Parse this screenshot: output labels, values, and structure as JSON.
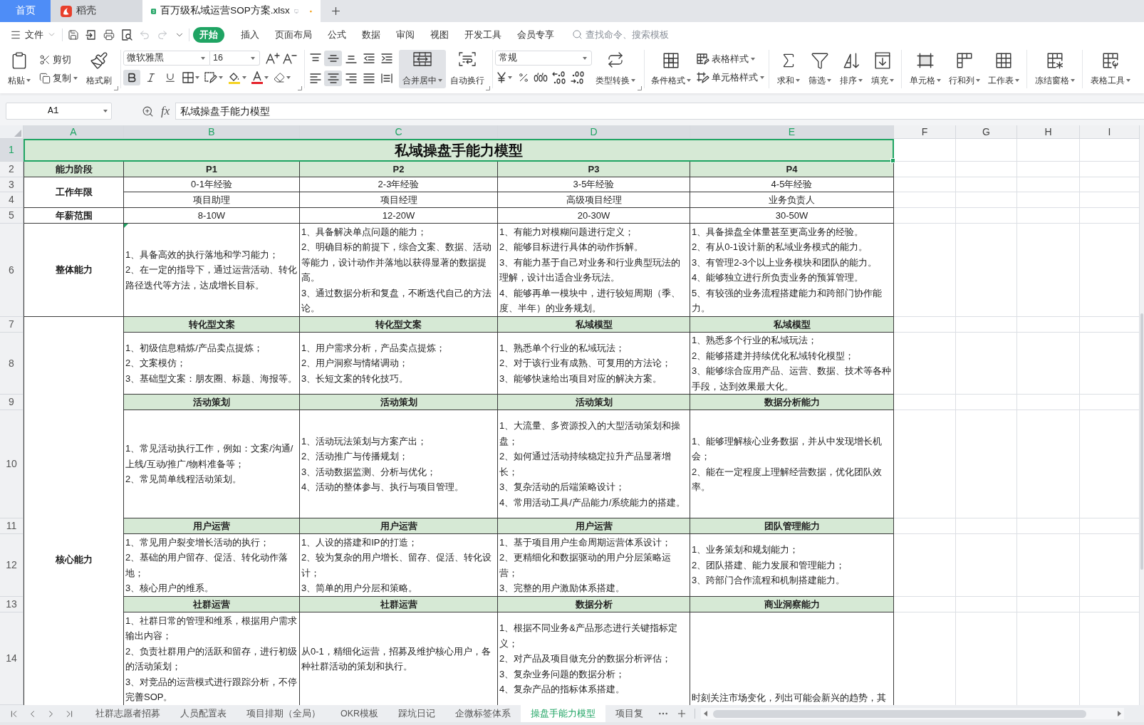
{
  "tabs": [
    {
      "kind": "home",
      "label": "首页",
      "selected": false,
      "unsaved": false
    },
    {
      "kind": "docer",
      "label": "稻壳",
      "selected": false,
      "unsaved": false
    },
    {
      "kind": "spreadsheet",
      "label": "百万级私域运营SOP方案.xlsx",
      "selected": true,
      "unsaved": true
    }
  ],
  "menu": {
    "file": "文件",
    "items": [
      {
        "label": "开始",
        "selected": true
      },
      {
        "label": "插入",
        "selected": false
      },
      {
        "label": "页面布局",
        "selected": false
      },
      {
        "label": "公式",
        "selected": false
      },
      {
        "label": "数据",
        "selected": false
      },
      {
        "label": "审阅",
        "selected": false
      },
      {
        "label": "视图",
        "selected": false
      },
      {
        "label": "开发工具",
        "selected": false
      },
      {
        "label": "会员专享",
        "selected": false
      }
    ],
    "search": {
      "placeholder": "查找命令、搜索模板"
    }
  },
  "toolbar": {
    "clipboard": {
      "paste": "粘贴",
      "cut": "剪切",
      "copy": "复制",
      "format_painter": "格式刷"
    },
    "font": {
      "name": "微软雅黑",
      "size": "16",
      "styles": [
        {
          "kind": "bold",
          "selected": true
        },
        {
          "kind": "italic",
          "selected": false
        },
        {
          "kind": "underline",
          "selected": false
        }
      ]
    },
    "alignment": {
      "vertical": [
        {
          "kind": "top",
          "selected": false
        },
        {
          "kind": "middle",
          "selected": true
        },
        {
          "kind": "bottom",
          "selected": false
        }
      ],
      "horizontal": [
        {
          "kind": "left",
          "selected": false
        },
        {
          "kind": "center",
          "selected": true
        },
        {
          "kind": "right",
          "selected": false
        },
        {
          "kind": "justify",
          "selected": false
        },
        {
          "kind": "distributed",
          "selected": false
        }
      ]
    },
    "layout_buttons": [
      {
        "kind": "merge",
        "label": "合并居中",
        "selected": true
      },
      {
        "kind": "wrap",
        "label": "自动换行",
        "selected": false
      }
    ],
    "number": {
      "format": "常规",
      "convert": "类型转换"
    },
    "styles": {
      "conditional": "条件格式",
      "table_style": "表格样式",
      "cell_style": "单元格样式"
    },
    "tool_groups": [
      [
        {
          "kind": "sum",
          "label": "求和"
        },
        {
          "kind": "filter",
          "label": "筛选"
        },
        {
          "kind": "sort",
          "label": "排序"
        },
        {
          "kind": "fill",
          "label": "填充"
        }
      ],
      [
        {
          "kind": "cell",
          "label": "单元格"
        },
        {
          "kind": "rows_columns",
          "label": "行和列"
        },
        {
          "kind": "worksheet",
          "label": "工作表"
        }
      ],
      [
        {
          "kind": "freeze",
          "label": "冻结窗格"
        }
      ],
      [
        {
          "kind": "table_tools",
          "label": "表格工具"
        }
      ]
    ]
  },
  "formula_bar": {
    "cell": "A1",
    "function_symbol": "fx",
    "value": "私域操盘手能力模型"
  },
  "sheet": {
    "columns": [
      {
        "label": "A",
        "selected": true
      },
      {
        "label": "B",
        "selected": true
      },
      {
        "label": "C",
        "selected": true
      },
      {
        "label": "D",
        "selected": true
      },
      {
        "label": "E",
        "selected": true
      },
      {
        "label": "F",
        "selected": false
      },
      {
        "label": "G",
        "selected": false
      },
      {
        "label": "H",
        "selected": false
      },
      {
        "label": "I",
        "selected": false
      }
    ],
    "rows": [
      {
        "label": "1",
        "selected": true
      },
      {
        "label": "2",
        "selected": false
      },
      {
        "label": "3",
        "selected": false
      },
      {
        "label": "4",
        "selected": false
      },
      {
        "label": "5",
        "selected": false
      },
      {
        "label": "6",
        "selected": false
      },
      {
        "label": "7",
        "selected": false
      },
      {
        "label": "8",
        "selected": false
      },
      {
        "label": "9",
        "selected": false
      },
      {
        "label": "10",
        "selected": false
      },
      {
        "label": "11",
        "selected": false
      },
      {
        "label": "12",
        "selected": false
      },
      {
        "label": "13",
        "selected": false
      },
      {
        "label": "14",
        "selected": false
      }
    ],
    "title": "私域操盘手能力模型",
    "stage": {
      "label": "能力阶段",
      "levels": [
        "P1",
        "P2",
        "P3",
        "P4"
      ]
    },
    "experience": {
      "label": "工作年限",
      "years": [
        "0-1年经验",
        "2-3年经验",
        "3-5年经验",
        "4-5年经验"
      ],
      "roles": [
        "项目助理",
        "项目经理",
        "高级项目经理",
        "业务负责人"
      ]
    },
    "salary": {
      "label": "年薪范围",
      "values": [
        "8-10W",
        "12-20W",
        "20-30W",
        "30-50W"
      ]
    },
    "overall": {
      "label": "整体能力",
      "cells": [
        [
          "1、具备高效的执行落地和学习能力；",
          "2、在一定的指导下，通过运营活动、转化路径迭代等方法，达成增长目标。"
        ],
        [
          "1、具备解决单点问题的能力；",
          "2、明确目标的前提下，综合文案、数据、活动等能力，设计动作并落地以获得显著的数据提高。",
          "3、通过数据分析和复盘，不断迭代自己的方法论。"
        ],
        [
          "1、有能力对模糊问题进行定义；",
          "2、能够目标进行具体的动作拆解。",
          "3、有能力基于自己对业务和行业典型玩法的理解，设计出适合业务玩法。",
          "4、能够再单一模块中，进行较短周期（季、度、半年）的业务规划。"
        ],
        [
          "1、具备操盘全体量甚至更高业务的经验。",
          "2、有从0-1设计新的私域业务模式的能力。",
          "3、有管理2-3个以上业务模块和团队的能力。",
          "4、能够独立进行所负责业务的预算管理。",
          "5、有较强的业务流程搭建能力和跨部门协作能力。"
        ]
      ]
    },
    "core": {
      "label": "核心能力",
      "sections": [
        {
          "headings": [
            "转化型文案",
            "转化型文案",
            "私域模型",
            "私域模型"
          ],
          "cells": [
            [
              "1、初级信息精炼/产品卖点提炼；",
              "2、文案模仿；",
              "3、基础型文案：朋友圈、标题、海报等。"
            ],
            [
              "1、用户需求分析，产品卖点提炼；",
              "2、用户洞察与情绪调动；",
              "3、长短文案的转化技巧。"
            ],
            [
              "1、熟悉单个行业的私域玩法；",
              "2、对于该行业有成熟、可复用的方法论；",
              "3、能够快速给出项目对应的解决方案。"
            ],
            [
              "1、熟悉多个行业的私域玩法；",
              "2、能够搭建并持续优化私域转化模型；",
              "3、能够综合应用产品、运营、数据、技术等各种手段，达到效果最大化。"
            ]
          ]
        },
        {
          "headings": [
            "活动策划",
            "活动策划",
            "活动策划",
            "数据分析能力"
          ],
          "cells": [
            [
              "1、常见活动执行工作，例如：文案/沟通/上线/互动/推广/物料准备等；",
              "2、常见简单线程活动策划。"
            ],
            [
              "1、活动玩法策划与方案产出；",
              "2、活动推广与传播规划；",
              "3、活动数据监测、分析与优化；",
              "4、活动的整体参与、执行与项目管理。"
            ],
            [
              "1、大流量、多资源投入的大型活动策划和操盘；",
              "2、如何通过活动持续稳定拉升产品显著增长；",
              "3、复杂活动的后端策略设计；",
              "4、常用活动工具/产品能力/系统能力的搭建。"
            ],
            [
              "1、能够理解核心业务数据，并从中发现增长机会；",
              "2、能在一定程度上理解经营数据，优化团队效率。"
            ]
          ]
        },
        {
          "headings": [
            "用户运营",
            "用户运营",
            "用户运营",
            "团队管理能力"
          ],
          "cells": [
            [
              "1、常见用户裂变增长活动的执行；",
              "2、基础的用户留存、促活、转化动作落地；",
              "3、核心用户的维系。"
            ],
            [
              "1、人设的搭建和IP的打造；",
              "2、较为复杂的用户增长、留存、促活、转化设计；",
              "3、简单的用户分层和策略。"
            ],
            [
              "1、基于项目用户生命周期运营体系设计；",
              "2、更精细化和数据驱动的用户分层策略运营；",
              "3、完整的用户激励体系搭建。"
            ],
            [
              "1、业务策划和规划能力；",
              "2、团队搭建、能力发展和管理能力；",
              "3、跨部门合作流程和机制搭建能力。"
            ]
          ]
        },
        {
          "headings": [
            "社群运营",
            "社群运营",
            "数据分析",
            "商业洞察能力"
          ],
          "cells": [
            [
              "1、社群日常的管理和维系，根据用户需求输出内容；",
              "2、负责社群用户的活跃和留存，进行初级的活动策划；",
              "3、对竞品的运营模式进行跟踪分析，不停完善SOP。"
            ],
            [
              "从0-1，精细化运营，招募及维护核心用户，各种社群活动的策划和执行。"
            ],
            [
              "1、根据不同业务&产品形态进行关键指标定义；",
              "2、对产品及项目做充分的数据分析评估；",
              "3、复杂业务问题的数据分析；",
              "4、复杂产品的指标体系搭建。"
            ],
            [
              "时刻关注市场变化，列出可能会新兴的趋势，其"
            ]
          ]
        }
      ]
    }
  },
  "sheet_tabs": {
    "items": [
      {
        "label": "社群志愿者招募",
        "selected": false
      },
      {
        "label": "人员配置表",
        "selected": false
      },
      {
        "label": "项目排期（全局）",
        "selected": false
      },
      {
        "label": "OKR模板",
        "selected": false
      },
      {
        "label": "踩坑日记",
        "selected": false
      },
      {
        "label": "企微标签体系",
        "selected": false
      },
      {
        "label": "操盘手能力模型",
        "selected": true
      },
      {
        "label": "项目复",
        "selected": false
      }
    ]
  }
}
